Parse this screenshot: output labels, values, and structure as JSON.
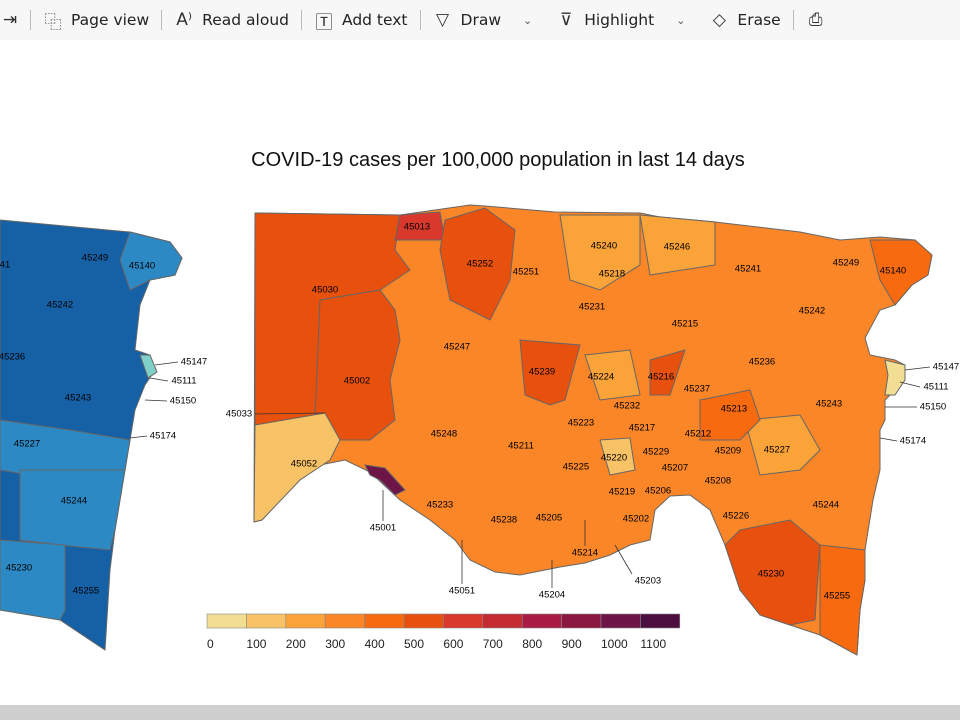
{
  "toolbar": {
    "items": [
      {
        "label": "Page view",
        "icon": "page-view-icon",
        "glyph": "⿻"
      },
      {
        "label": "Read aloud",
        "icon": "read-aloud-icon",
        "glyph": "A⁾"
      },
      {
        "label": "Add text",
        "icon": "add-text-icon",
        "glyph": "🅃"
      },
      {
        "label": "Draw",
        "icon": "draw-icon",
        "glyph": "▽",
        "dropdown": true
      },
      {
        "label": "Highlight",
        "icon": "highlight-icon",
        "glyph": "⊽",
        "dropdown": true
      },
      {
        "label": "Erase",
        "icon": "eraser-icon",
        "glyph": "◇"
      }
    ]
  },
  "map": {
    "title": "COVID-19 cases per 100,000 population in last 14 days",
    "legend": {
      "ticks": [
        "0",
        "100",
        "200",
        "300",
        "400",
        "500",
        "600",
        "700",
        "800",
        "900",
        "1000",
        "1100"
      ],
      "colors": [
        "#f1de93",
        "#f8c367",
        "#f9a338",
        "#fa8628",
        "#f76a10",
        "#e8500e",
        "#d8392c",
        "#c42a32",
        "#a81c45",
        "#8b1840",
        "#6d1547",
        "#4b0e3f"
      ]
    },
    "zip_labels": [
      "45013",
      "45252",
      "45251",
      "45240",
      "45218",
      "45246",
      "45241",
      "45249",
      "45140",
      "45030",
      "45231",
      "45215",
      "45242",
      "45247",
      "45239",
      "45224",
      "45216",
      "45237",
      "45236",
      "45002",
      "45232",
      "45213",
      "45243",
      "45223",
      "45217",
      "45212",
      "45248",
      "45211",
      "45229",
      "45209",
      "45227",
      "45220",
      "45207",
      "45052",
      "45225",
      "45208",
      "45219",
      "45206",
      "45233",
      "45244",
      "45238",
      "45205",
      "45202",
      "45226",
      "45230",
      "45255"
    ],
    "callout_labels": [
      "45147",
      "45111",
      "45150",
      "45174",
      "45033",
      "45001",
      "45214",
      "45203",
      "45051",
      "45204"
    ],
    "left_map_labels": [
      "41",
      "45249",
      "45140",
      "45242",
      "45236",
      "45243",
      "45227",
      "45244",
      "45230",
      "45255"
    ],
    "left_callouts": [
      "45147",
      "45111",
      "45150",
      "45174"
    ]
  }
}
